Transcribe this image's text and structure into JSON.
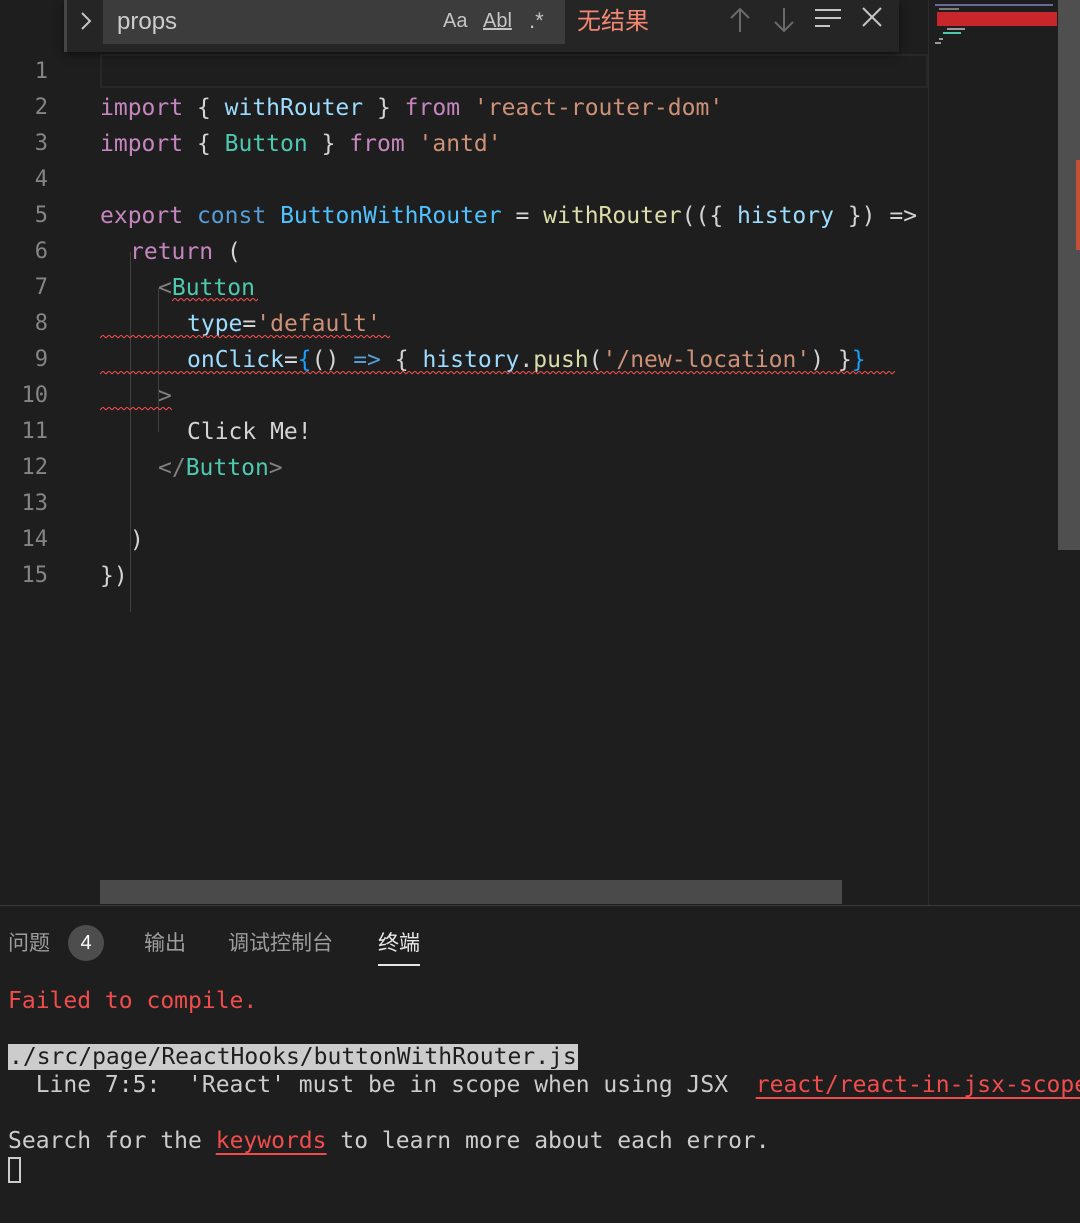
{
  "find": {
    "query": "props",
    "match_case_label": "Aa",
    "whole_word_label": "Abl",
    "regex_label": ".*",
    "result": "无结果"
  },
  "editor": {
    "line_numbers": [
      "1",
      "2",
      "3",
      "4",
      "5",
      "6",
      "7",
      "8",
      "9",
      "10",
      "11",
      "12",
      "13",
      "14",
      "15"
    ],
    "code": {
      "l2": {
        "kw": "import",
        "a": " { ",
        "id": "withRouter",
        "b": " } ",
        "from": "from",
        "str": "'react-router-dom'"
      },
      "l3": {
        "kw": "import",
        "a": " { ",
        "id": "Button",
        "b": " } ",
        "from": "from",
        "str": "'antd'"
      },
      "l5": {
        "kw": "export",
        "c": "const",
        "name": "ButtonWithRouter",
        "eq": " = ",
        "fn": "withRouter",
        "p": "(({ ",
        "arg": "history",
        "q": " }) =>"
      },
      "l6": {
        "kw": "return",
        "p": " ("
      },
      "l7": {
        "lt": "<",
        "tag": "Button"
      },
      "l8": {
        "attr": "type",
        "eq": "=",
        "str": "'default'"
      },
      "l9": {
        "attr": "onClick",
        "eq": "=",
        "ob": "{",
        "a": "() ",
        "arrow": "=>",
        "b": " { ",
        "obj": "history",
        "dot": ".",
        "meth": "push",
        "po": "(",
        "str": "'/new-location'",
        "pc": ") }",
        "cb": "}"
      },
      "l10": {
        "gt": ">"
      },
      "l11": {
        "text": "Click Me!"
      },
      "l12": {
        "lt": "</",
        "tag": "Button",
        "gt": ">"
      },
      "l14": {
        "p": ")"
      },
      "l15": {
        "p": "})"
      }
    }
  },
  "panel": {
    "tabs": [
      "问题",
      "输出",
      "调试控制台",
      "终端"
    ],
    "problem_count": "4",
    "active_tab": "终端"
  },
  "terminal": {
    "failed": "Failed to compile.",
    "file": "./src/page/ReactHooks/buttonWithRouter.js",
    "error_line": "  Line 7:5:  'React' must be in scope when using JSX  ",
    "rule": "react/react-in-jsx-scope",
    "search_pre": "Search for the ",
    "search_link": "keywords",
    "search_post": " to learn more about each error."
  },
  "colors": {
    "error": "#f14c4c",
    "keyword": "#c586c0",
    "string": "#ce9178",
    "component": "#4ec9b0"
  }
}
